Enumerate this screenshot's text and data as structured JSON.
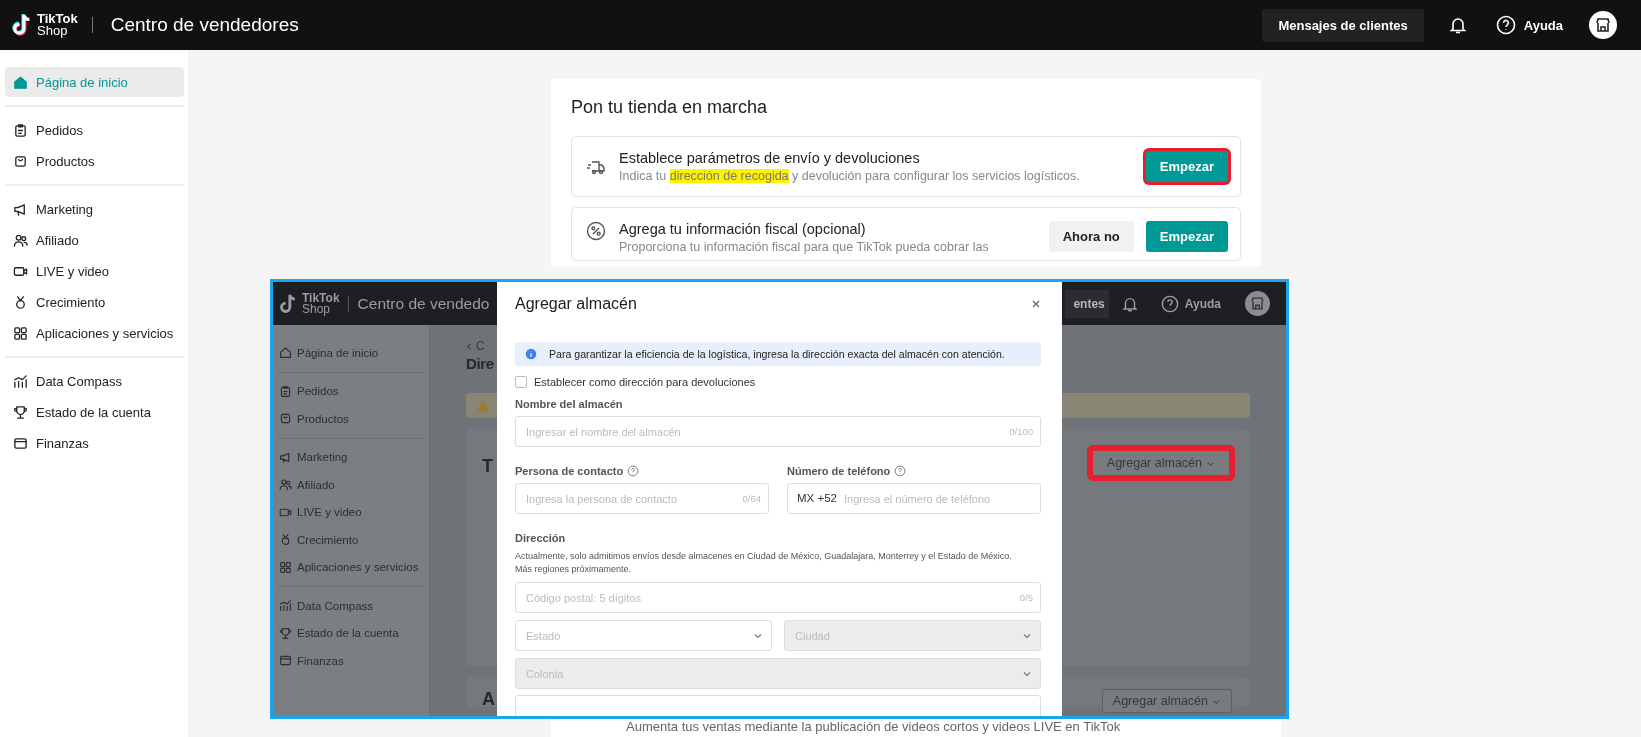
{
  "header": {
    "logo": {
      "line_1": "TikTok",
      "line_2": "Shop"
    },
    "title": "Centro de vendedores",
    "messages_button": "Mensajes de clientes",
    "help": "Ayuda"
  },
  "sidebar": {
    "groups": [
      {
        "items": [
          {
            "label": "Página de inicio",
            "selected": true
          }
        ]
      },
      {
        "items": [
          {
            "label": "Pedidos",
            "selected": false
          },
          {
            "label": "Productos",
            "selected": false
          }
        ]
      },
      {
        "items": [
          {
            "label": "Marketing",
            "selected": false
          },
          {
            "label": "Afiliado",
            "selected": false
          },
          {
            "label": "LIVE y video",
            "selected": false
          },
          {
            "label": "Crecimiento",
            "selected": false
          },
          {
            "label": "Aplicaciones y servicios",
            "selected": false
          }
        ]
      },
      {
        "items": [
          {
            "label": "Data Compass",
            "selected": false
          },
          {
            "label": "Estado de la cuenta",
            "selected": false
          },
          {
            "label": "Finanzas",
            "selected": false
          }
        ]
      }
    ]
  },
  "setup_card": {
    "title": "Pon tu tienda en marcha",
    "tasks": [
      {
        "title": "Establece parámetros de envío y devoluciones",
        "description": [
          {
            "text": "Indica tu ",
            "highlight": false
          },
          {
            "text": "dirección de recogida",
            "highlight": true
          },
          {
            "text": " y devolución para configurar los servicios logísticos.",
            "highlight": false
          }
        ],
        "buttons": [
          {
            "label": "Empezar",
            "kind": "primary",
            "highlighted": true
          }
        ]
      },
      {
        "title": "Agrega tu información fiscal (opcional)",
        "description": [
          {
            "text": "Proporciona tu información fiscal para que TikTok pueda cobrar las",
            "highlight": false
          }
        ],
        "buttons": [
          {
            "label": "Ahora no",
            "kind": "secondary",
            "highlighted": false
          },
          {
            "label": "Empezar",
            "kind": "primary",
            "highlighted": false
          }
        ]
      }
    ]
  },
  "promo_card": {
    "description": "Aumenta tus ventas mediante la publicación de videos cortos y videos LIVE en TikTok"
  },
  "inset": {
    "header": {
      "logo": {
        "line_1": "TikTok",
        "line_2": "Shop"
      },
      "title": "Centro de vendedo",
      "messages_button": "entes",
      "help": "Ayuda"
    },
    "sidebar": {
      "groups": [
        {
          "items": [
            {
              "label": "Página de inicio"
            }
          ]
        },
        {
          "items": [
            {
              "label": "Pedidos"
            },
            {
              "label": "Productos"
            }
          ]
        },
        {
          "items": [
            {
              "label": "Marketing"
            },
            {
              "label": "Afiliado"
            },
            {
              "label": "LIVE y video"
            },
            {
              "label": "Crecimiento"
            },
            {
              "label": "Aplicaciones y servicios"
            }
          ]
        },
        {
          "items": [
            {
              "label": "Data Compass"
            },
            {
              "label": "Estado de la cuenta"
            },
            {
              "label": "Finanzas"
            }
          ]
        }
      ]
    },
    "page": {
      "back_link": "C",
      "title": "Dire",
      "sections": [
        {
          "title": "T",
          "button": {
            "label": "Agregar almacén",
            "highlighted": true
          }
        },
        {
          "title": "A",
          "button": {
            "label": "Agregar almacén",
            "highlighted": false
          }
        }
      ]
    },
    "modal": {
      "title": "Agregar almacén",
      "notice": "Para garantizar la eficiencia de la logística, ingresa la dirección exacta del almacén con atención.",
      "return_address": {
        "label": "Establecer como dirección para devoluciones",
        "checked": false
      },
      "warehouse_name": {
        "label": "Nombre del almacén",
        "placeholder": "Ingresar el nombre del almacén",
        "counter": "0/100"
      },
      "contact": {
        "label": "Persona de contacto",
        "placeholder": "Ingresa la persona de contacto",
        "counter": "0/64"
      },
      "phone": {
        "label": "Número de teléfono",
        "prefix": "MX +52",
        "placeholder": "Ingresa el número de teléfono"
      },
      "address": {
        "label": "Dirección",
        "hint": [
          "Actualmente, solo admitimos envíos desde almacenes en Ciudad de México, Guadalajara, Monterrey y el Estado de México.",
          "Más regiones próximamente."
        ],
        "postal_code": {
          "placeholder": "Código postal: 5 dígitos",
          "counter": "0/5"
        },
        "selects": [
          {
            "placeholder": "Estado",
            "disabled": false
          },
          {
            "placeholder": "Ciudad",
            "disabled": true
          },
          {
            "placeholder": "Colonia",
            "disabled": true
          }
        ]
      }
    }
  }
}
